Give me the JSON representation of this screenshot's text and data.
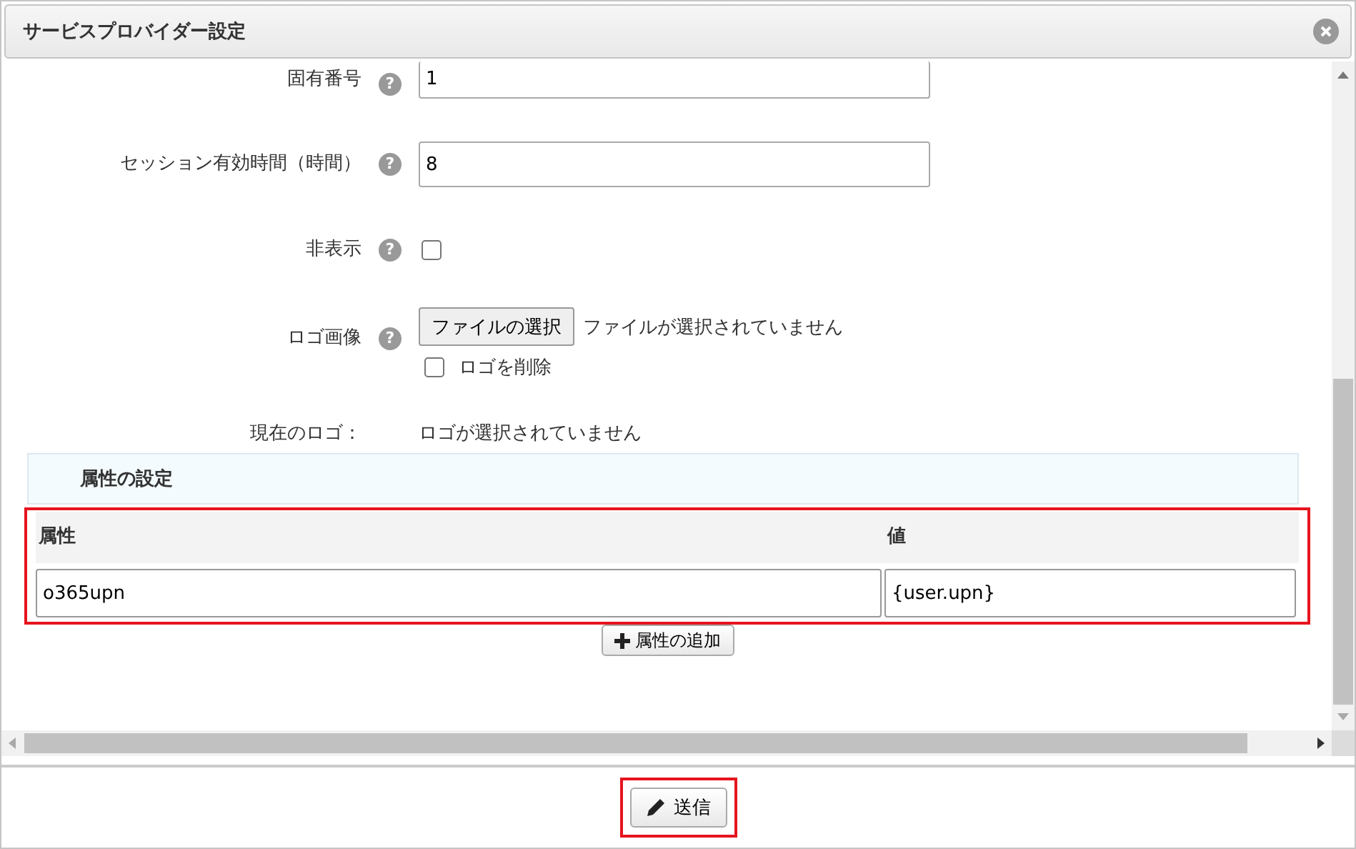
{
  "dialog": {
    "title": "サービスプロバイダー設定"
  },
  "fields": [
    {
      "kind": "text",
      "label": "固有番号",
      "help": "?",
      "value": "1"
    },
    {
      "kind": "text",
      "label": "セッション有効時間（時間）",
      "help": "?",
      "value": "8"
    },
    {
      "kind": "checkbox",
      "label": "非表示",
      "help": "?",
      "checked": false
    },
    {
      "kind": "file",
      "label": "ロゴ画像",
      "help": "?",
      "button": "ファイルの選択",
      "status": "ファイルが選択されていません",
      "delete_label": "ロゴを削除",
      "delete_checked": false
    }
  ],
  "current_logo": {
    "label": "現在のロゴ：",
    "value": "ロゴが選択されていません"
  },
  "attributes": {
    "title": "属性の設定",
    "columns": [
      "属性",
      "値"
    ],
    "rows": [
      {
        "name": "o365upn",
        "value": "{user.upn}"
      }
    ],
    "add_button": "属性の追加",
    "highlighted": true
  },
  "submit": {
    "label": "送信",
    "highlighted": true
  }
}
